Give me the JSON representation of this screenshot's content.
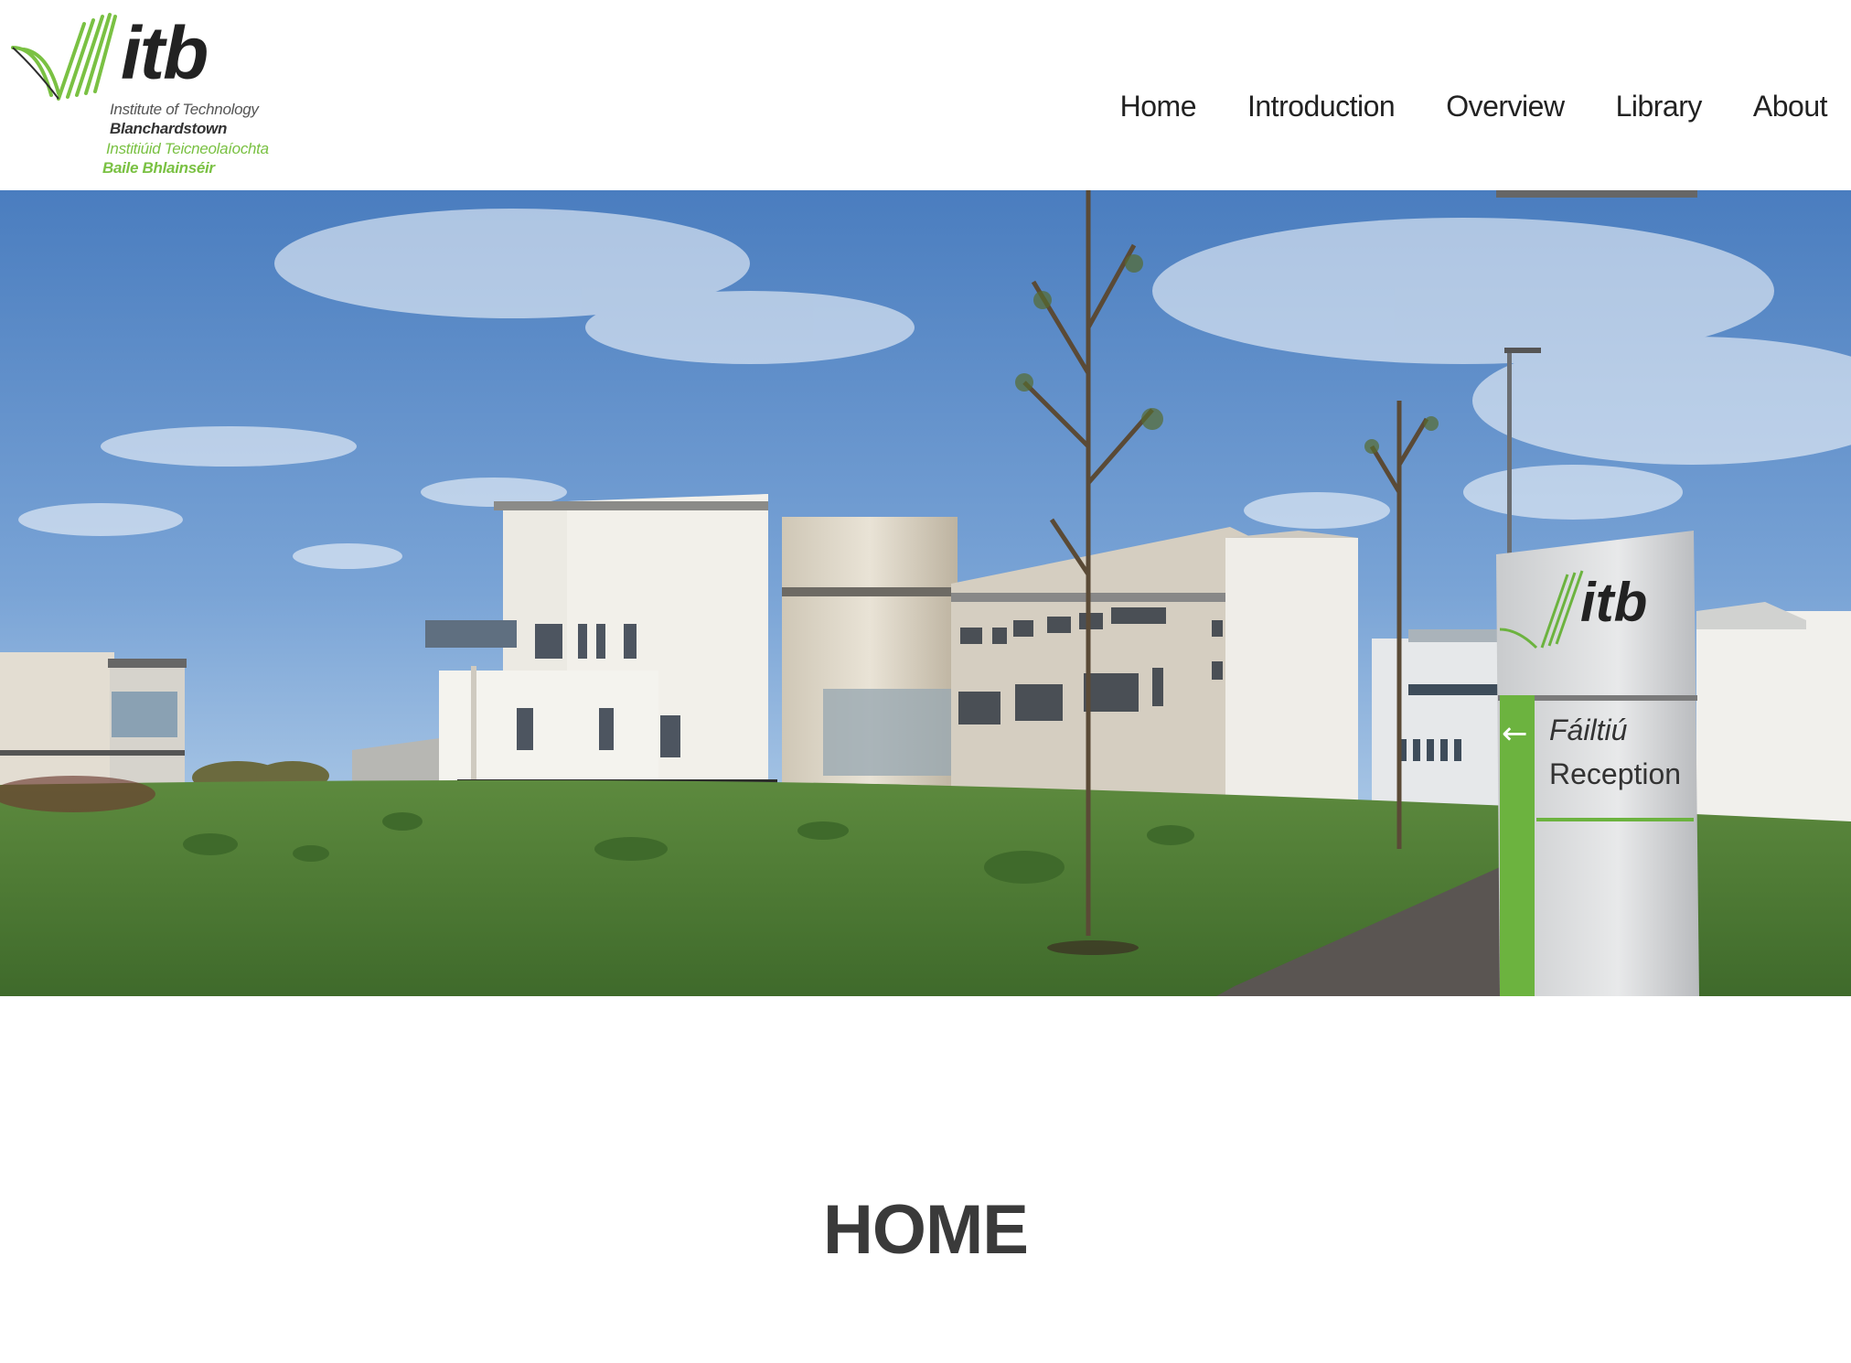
{
  "logo": {
    "wordmark": "itb",
    "line1": "Institute of Technology",
    "line2": "Blanchardstown",
    "line3": "Institiúid Teicneolaíochta",
    "line4": "Baile Bhlainséir",
    "green": "#7ac143"
  },
  "nav": {
    "items": [
      {
        "label": "Home"
      },
      {
        "label": "Introduction"
      },
      {
        "label": "Overview"
      },
      {
        "label": "Library"
      },
      {
        "label": "About"
      }
    ]
  },
  "hero": {
    "sign_brand": "itb",
    "sign_line1": "Fáiltiú",
    "sign_line2": "Reception",
    "sign_arrow": "←",
    "sky_color": "#5b8ac7",
    "grass_color": "#4f7a35"
  },
  "main": {
    "title": "HOME"
  }
}
